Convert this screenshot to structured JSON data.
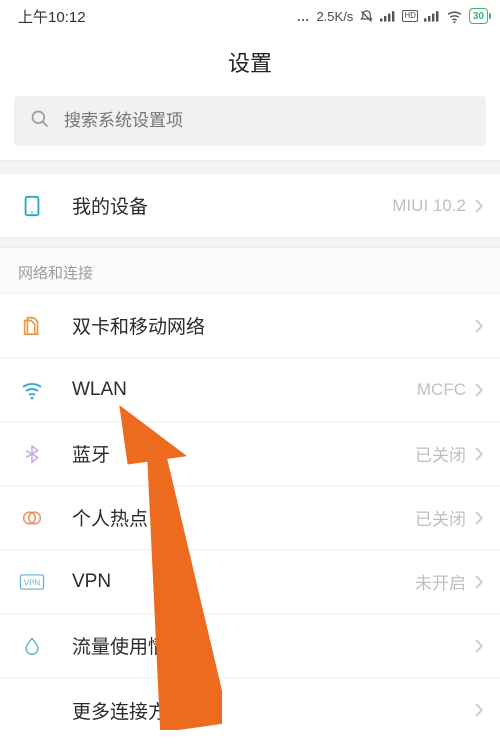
{
  "status": {
    "time": "上午10:12",
    "dots": "…",
    "speed": "2.5K/s",
    "battery": "30"
  },
  "title": "设置",
  "search": {
    "placeholder": "搜索系统设置项"
  },
  "my_device": {
    "label": "我的设备",
    "value": "MIUI 10.2"
  },
  "section_net": "网络和连接",
  "rows": {
    "sim": {
      "label": "双卡和移动网络",
      "value": ""
    },
    "wlan": {
      "label": "WLAN",
      "value": "MCFC"
    },
    "bt": {
      "label": "蓝牙",
      "value": "已关闭"
    },
    "hotspot": {
      "label": "个人热点",
      "value": "已关闭"
    },
    "vpn": {
      "label": "VPN",
      "value": "未开启"
    },
    "data": {
      "label": "流量使用情况",
      "value": ""
    },
    "more": {
      "label": "更多连接方式",
      "value": ""
    }
  }
}
